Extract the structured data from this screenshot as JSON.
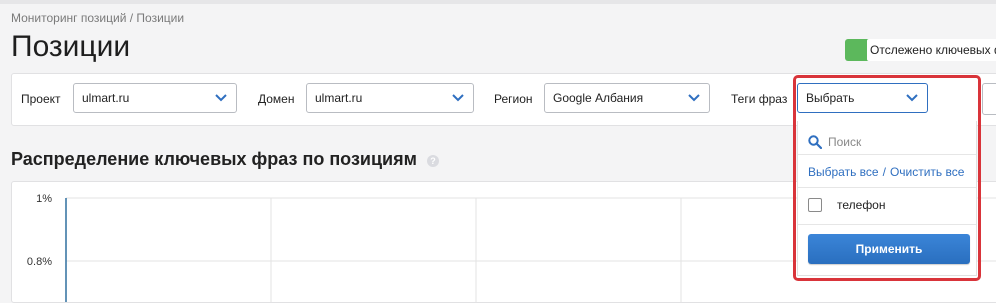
{
  "breadcrumb": "Мониторинг позиций / Позиции",
  "page_title": "Позиции",
  "tracked_label": "Отслежено ключевых фр",
  "filters": {
    "project": {
      "label": "Проект",
      "value": "ulmart.ru"
    },
    "domain": {
      "label": "Домен",
      "value": "ulmart.ru"
    },
    "region": {
      "label": "Регион",
      "value": "Google Албания"
    },
    "tags": {
      "label": "Теги фраз",
      "value": "Выбрать"
    }
  },
  "section_title": "Распределение ключевых фраз по позициям",
  "help_icon": "?",
  "tag_dropdown": {
    "search_placeholder": "Поиск",
    "select_all": "Выбрать все",
    "separator": "/",
    "clear_all": "Очистить все",
    "items": [
      {
        "label": "телефон",
        "checked": false
      }
    ],
    "apply_label": "Применить"
  },
  "chart_data": {
    "type": "line",
    "y_ticks": [
      "1%",
      "0.8%"
    ],
    "grid": true
  },
  "colors": {
    "accent": "#2f6fc0",
    "highlight": "#d9343a",
    "tracked": "#5cb85c"
  }
}
